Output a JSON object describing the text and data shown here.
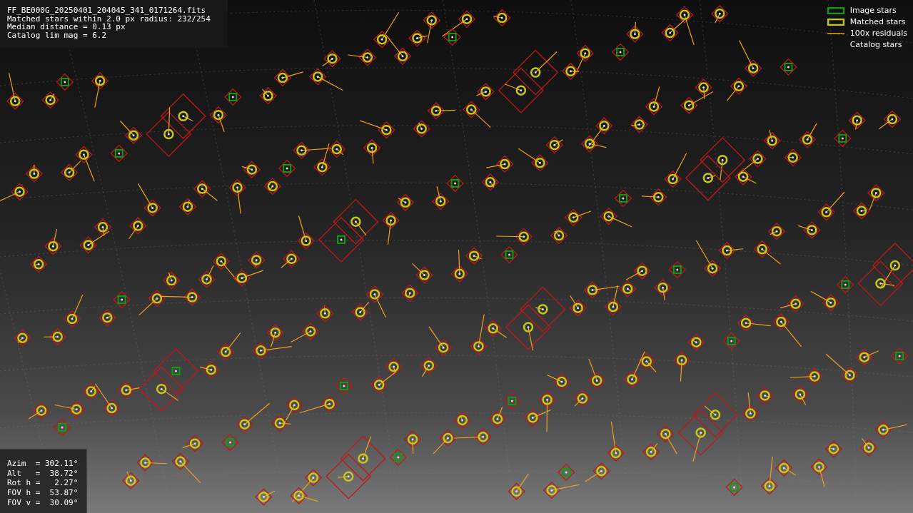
{
  "header": {
    "lines": [
      "FF_BE000G_20250401_204045_341_0171264.fits",
      "Matched stars within 2.0 px radius: 232/254",
      "Median distance = 0.13 px",
      "Catalog lim mag = 6.2"
    ]
  },
  "legend": [
    {
      "kind": "image",
      "label": "Image stars"
    },
    {
      "kind": "matched",
      "label": "Matched stars"
    },
    {
      "kind": "residual",
      "label": "100x residuals"
    },
    {
      "kind": "catalog",
      "label": "Catalog stars"
    }
  ],
  "pointing": {
    "lines": [
      "Azim  = 302.11°",
      "Alt   =  38.72°",
      "Rot h =   2.27°",
      "FOV h =  53.87°",
      "FOV v =  30.09°"
    ]
  }
}
